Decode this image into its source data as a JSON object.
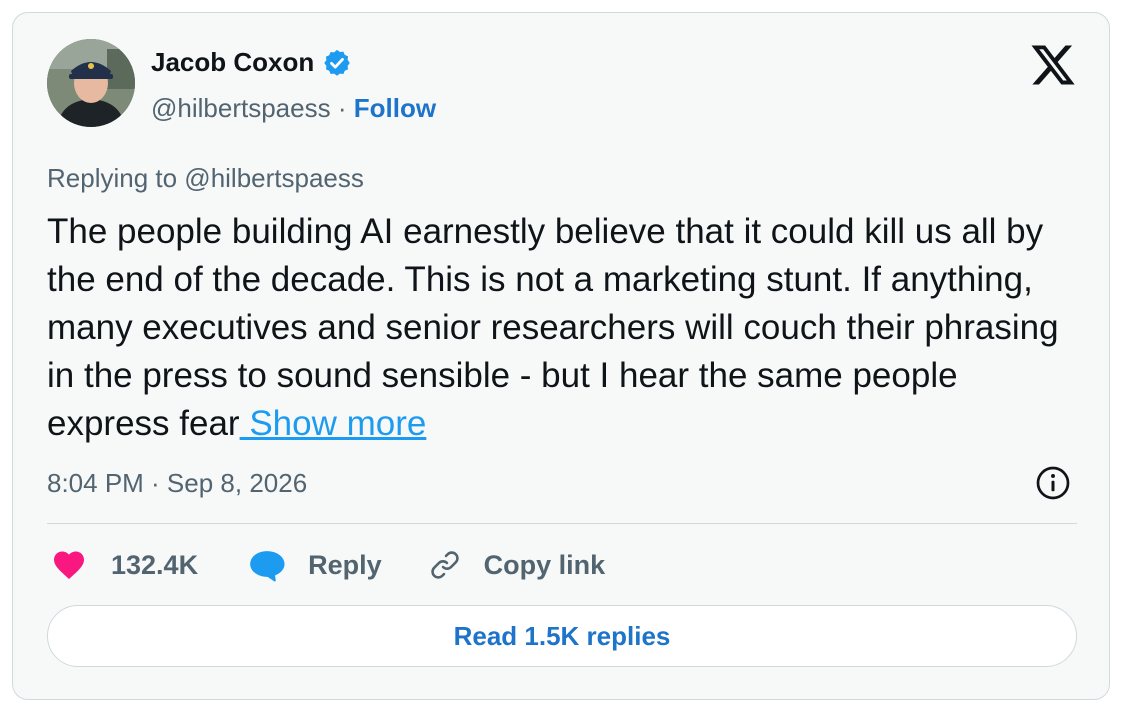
{
  "author": {
    "name": "Jacob Coxon",
    "handle": "@hilbertspaess",
    "separator": "·",
    "follow_label": "Follow",
    "verified": true
  },
  "tweet": {
    "replying_to": "Replying to @hilbertspaess",
    "text": "The people building AI earnestly believe that it could kill us all by the end of the decade. This is not a marketing stunt. If anything, many executives and senior researchers will couch their phrasing in the press to sound sensible - but I hear the same people express fear",
    "show_more_label": " Show more",
    "timestamp": "8:04 PM · Sep 8, 2026"
  },
  "actions": {
    "likes_count": "132.4K",
    "reply_label": "Reply",
    "copy_link_label": "Copy link"
  },
  "read_replies_label": "Read 1.5K replies",
  "icons": {
    "verified": "verified-badge-icon",
    "platform": "x-logo-icon",
    "info": "info-icon",
    "like": "heart-icon",
    "reply": "speech-bubble-icon",
    "copy": "link-icon"
  },
  "colors": {
    "accent_link": "#1d9bf0",
    "follow_blue": "#1d74c9",
    "heart": "#f91880",
    "verified": "#1d9bf0",
    "text_primary": "#0f1419",
    "text_secondary": "#536471"
  }
}
